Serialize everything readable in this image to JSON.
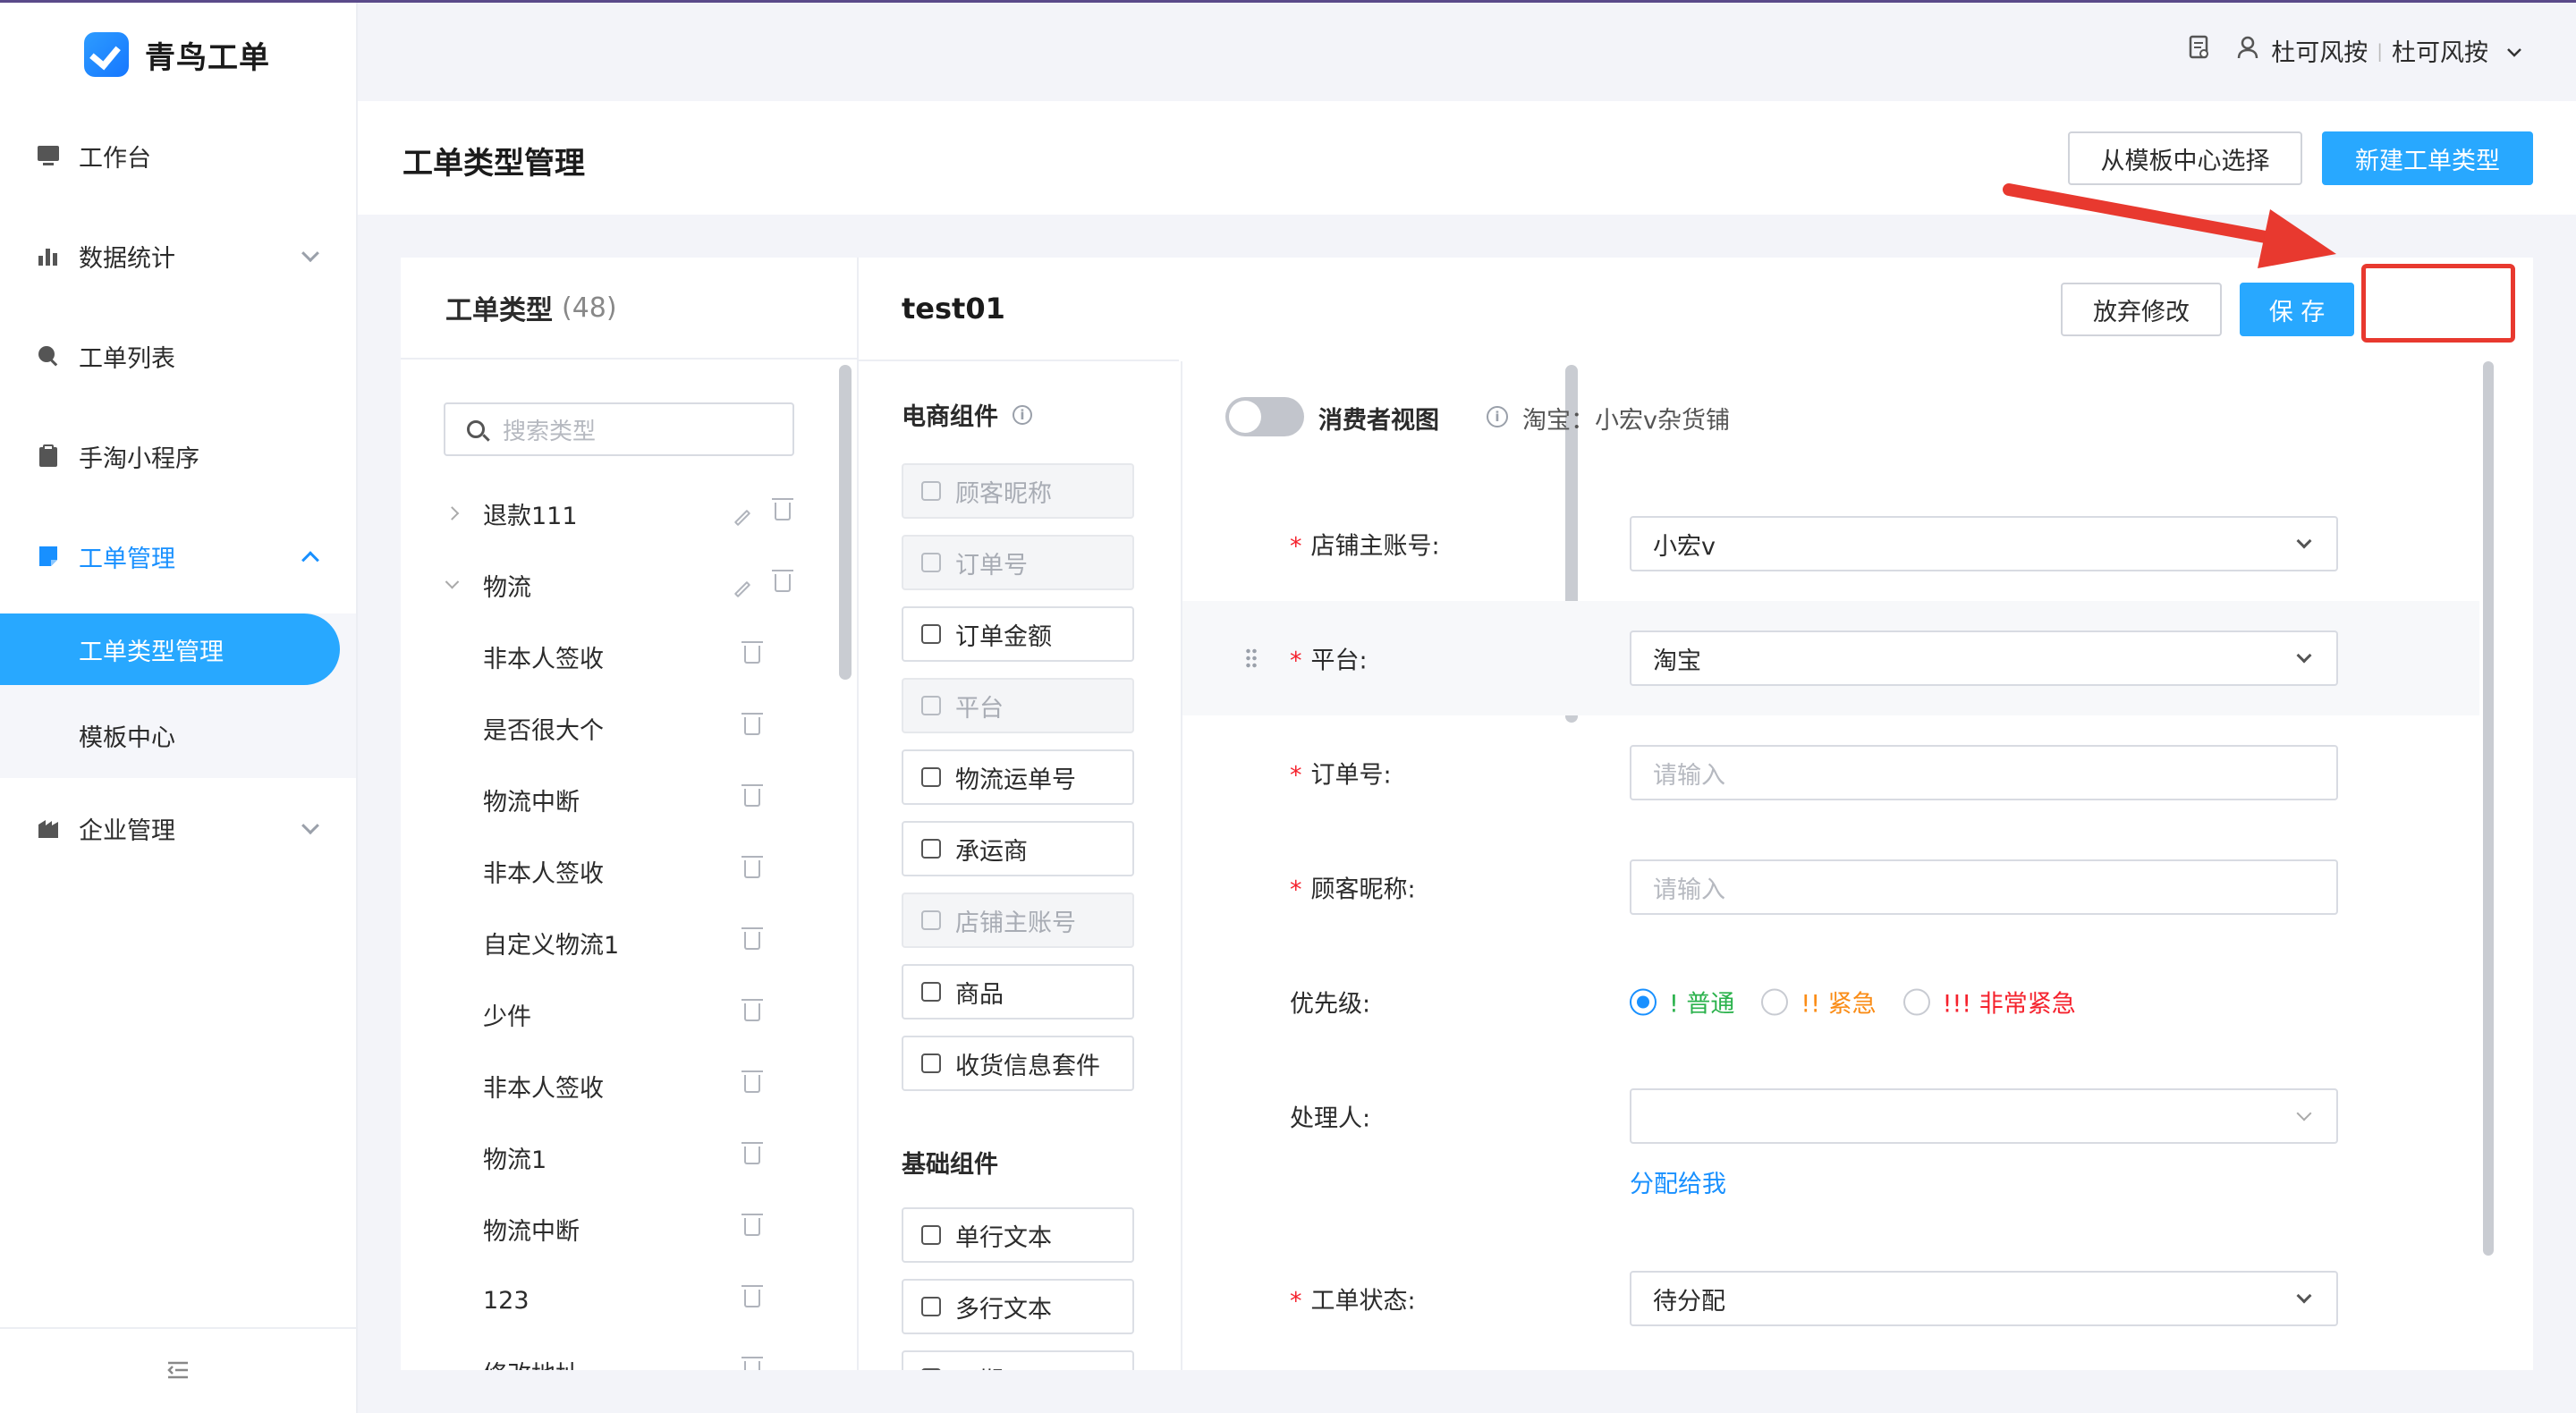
{
  "app": {
    "brand": "青鸟工单"
  },
  "header": {
    "user_name": "杜可风按",
    "org_name": "杜可风按"
  },
  "sidebar": {
    "items": [
      {
        "label": "工作台"
      },
      {
        "label": "数据统计"
      },
      {
        "label": "工单列表"
      },
      {
        "label": "手淘小程序"
      },
      {
        "label": "工单管理"
      },
      {
        "label": "企业管理"
      }
    ],
    "sub_items": [
      {
        "label": "工单类型管理"
      },
      {
        "label": "模板中心"
      }
    ]
  },
  "page": {
    "title": "工单类型管理",
    "template_button": "从模板中心选择",
    "new_type_button": "新建工单类型"
  },
  "types_panel": {
    "title": "工单类型",
    "count": "(48)",
    "search_placeholder": "搜索类型",
    "items": [
      {
        "label": "退款111"
      },
      {
        "label": "物流"
      },
      {
        "label": "非本人签收"
      },
      {
        "label": "是否很大个"
      },
      {
        "label": "物流中断"
      },
      {
        "label": "非本人签收"
      },
      {
        "label": "自定义物流1"
      },
      {
        "label": "少件"
      },
      {
        "label": "非本人签收"
      },
      {
        "label": "物流1"
      },
      {
        "label": "物流中断"
      },
      {
        "label": "123"
      },
      {
        "label": "修改地址"
      }
    ]
  },
  "editor": {
    "form_name": "test01",
    "discard_button": "放弃修改",
    "save_button": "保 存",
    "palette": {
      "ecommerce_title": "电商组件",
      "ecommerce": [
        "顾客昵称",
        "订单号",
        "订单金额",
        "平台",
        "物流运单号",
        "承运商",
        "店铺主账号",
        "商品",
        "收货信息套件"
      ],
      "basic_title": "基础组件",
      "basic": [
        "单行文本",
        "多行文本",
        "日期"
      ]
    },
    "consumer_view_label": "消费者视图",
    "shop_info": "淘宝：小宏v杂货铺",
    "fields": {
      "shop_account": {
        "label": "店铺主账号:",
        "value": "小宏v"
      },
      "platform": {
        "label": "平台:",
        "value": "淘宝"
      },
      "order_no": {
        "label": "订单号:",
        "placeholder": "请输入"
      },
      "customer_nick": {
        "label": "顾客昵称:",
        "placeholder": "请输入"
      },
      "priority": {
        "label": "优先级:",
        "options": [
          {
            "label": "! 普通",
            "color": "#2bb24c"
          },
          {
            "label": "!! 紧急",
            "color": "#fa8c16"
          },
          {
            "label": "!!! 非常紧急",
            "color": "#f5222d"
          }
        ],
        "selected": "! 普通"
      },
      "handler": {
        "label": "处理人:",
        "value": "",
        "assign_me": "分配给我"
      },
      "status": {
        "label": "工单状态:",
        "value": "待分配"
      }
    }
  },
  "colors": {
    "primary": "#28a8ff",
    "annotation": "#e8392f"
  }
}
